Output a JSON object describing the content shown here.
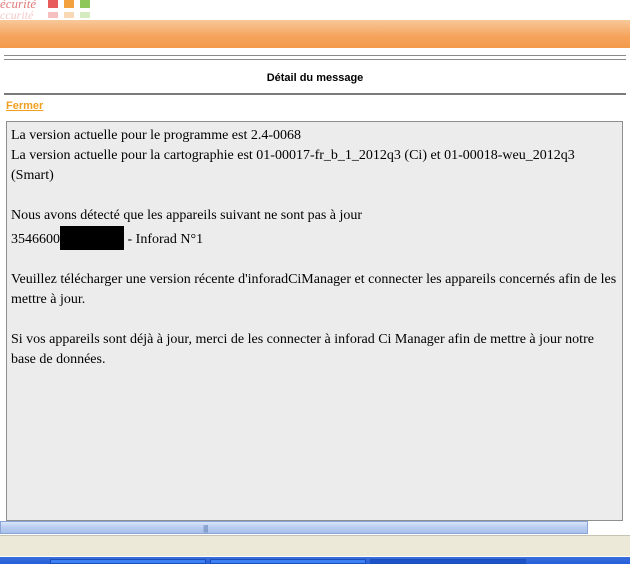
{
  "header": {
    "logo_text": "écurité",
    "logo_ghost_text": "ccurité"
  },
  "colors": {
    "logo_squares": [
      "#e85c5c",
      "#f3a13c",
      "#8fc75a"
    ],
    "banner": "#f6a35a",
    "link": "#f0a020"
  },
  "page": {
    "title": "Détail du message",
    "close_label": "Fermer"
  },
  "message": {
    "line1": "La version actuelle pour le programme est 2.4-0068",
    "line2": "La version actuelle pour la cartographie est 01-00017-fr_b_1_2012q3 (Ci) et 01-00018-weu_2012q3 (Smart)",
    "line3": "Nous avons détecté que les appareils suivant ne sont pas à jour",
    "device_prefix": "3546600",
    "device_suffix": " - Inforad N°1",
    "line4": "Veuillez télécharger une version récente d'inforadCiManager et connecter les appareils concernés afin de les mettre à jour.",
    "line5": "Si vos appareils sont déjà à jour, merci de les connecter à inforad Ci Manager afin de mettre à jour notre base de données."
  },
  "scrollbar": {
    "grip": "||||"
  }
}
